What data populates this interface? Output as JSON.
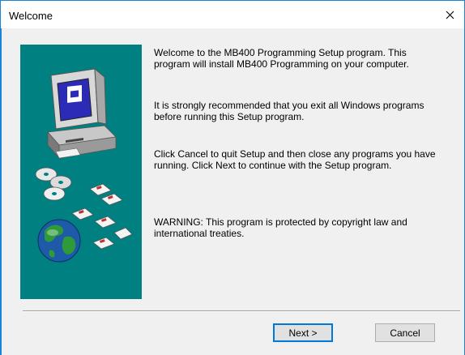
{
  "window": {
    "title": "Welcome",
    "close_glyph": "close-icon"
  },
  "content": {
    "paragraphs": [
      "Welcome to the MB400 Programming Setup program. This\nprogram will install MB400 Programming on your computer.",
      "It is strongly recommended that you exit all Windows programs\nbefore running this Setup program.",
      "Click Cancel to quit Setup and then close any programs you have\nrunning. Click Next to continue with the Setup program.",
      "WARNING: This program is protected by copyright law and\ninternational treaties."
    ]
  },
  "illustration": {
    "background": "#008080",
    "icons": [
      "computer-icon",
      "disc-icon",
      "floppy-disk-icon",
      "globe-icon"
    ]
  },
  "buttons": {
    "next": "Next >",
    "cancel": "Cancel"
  },
  "colors": {
    "accent": "#0078d7",
    "window_border": "#1883d7",
    "dialog_bg": "#f0f0f0"
  }
}
